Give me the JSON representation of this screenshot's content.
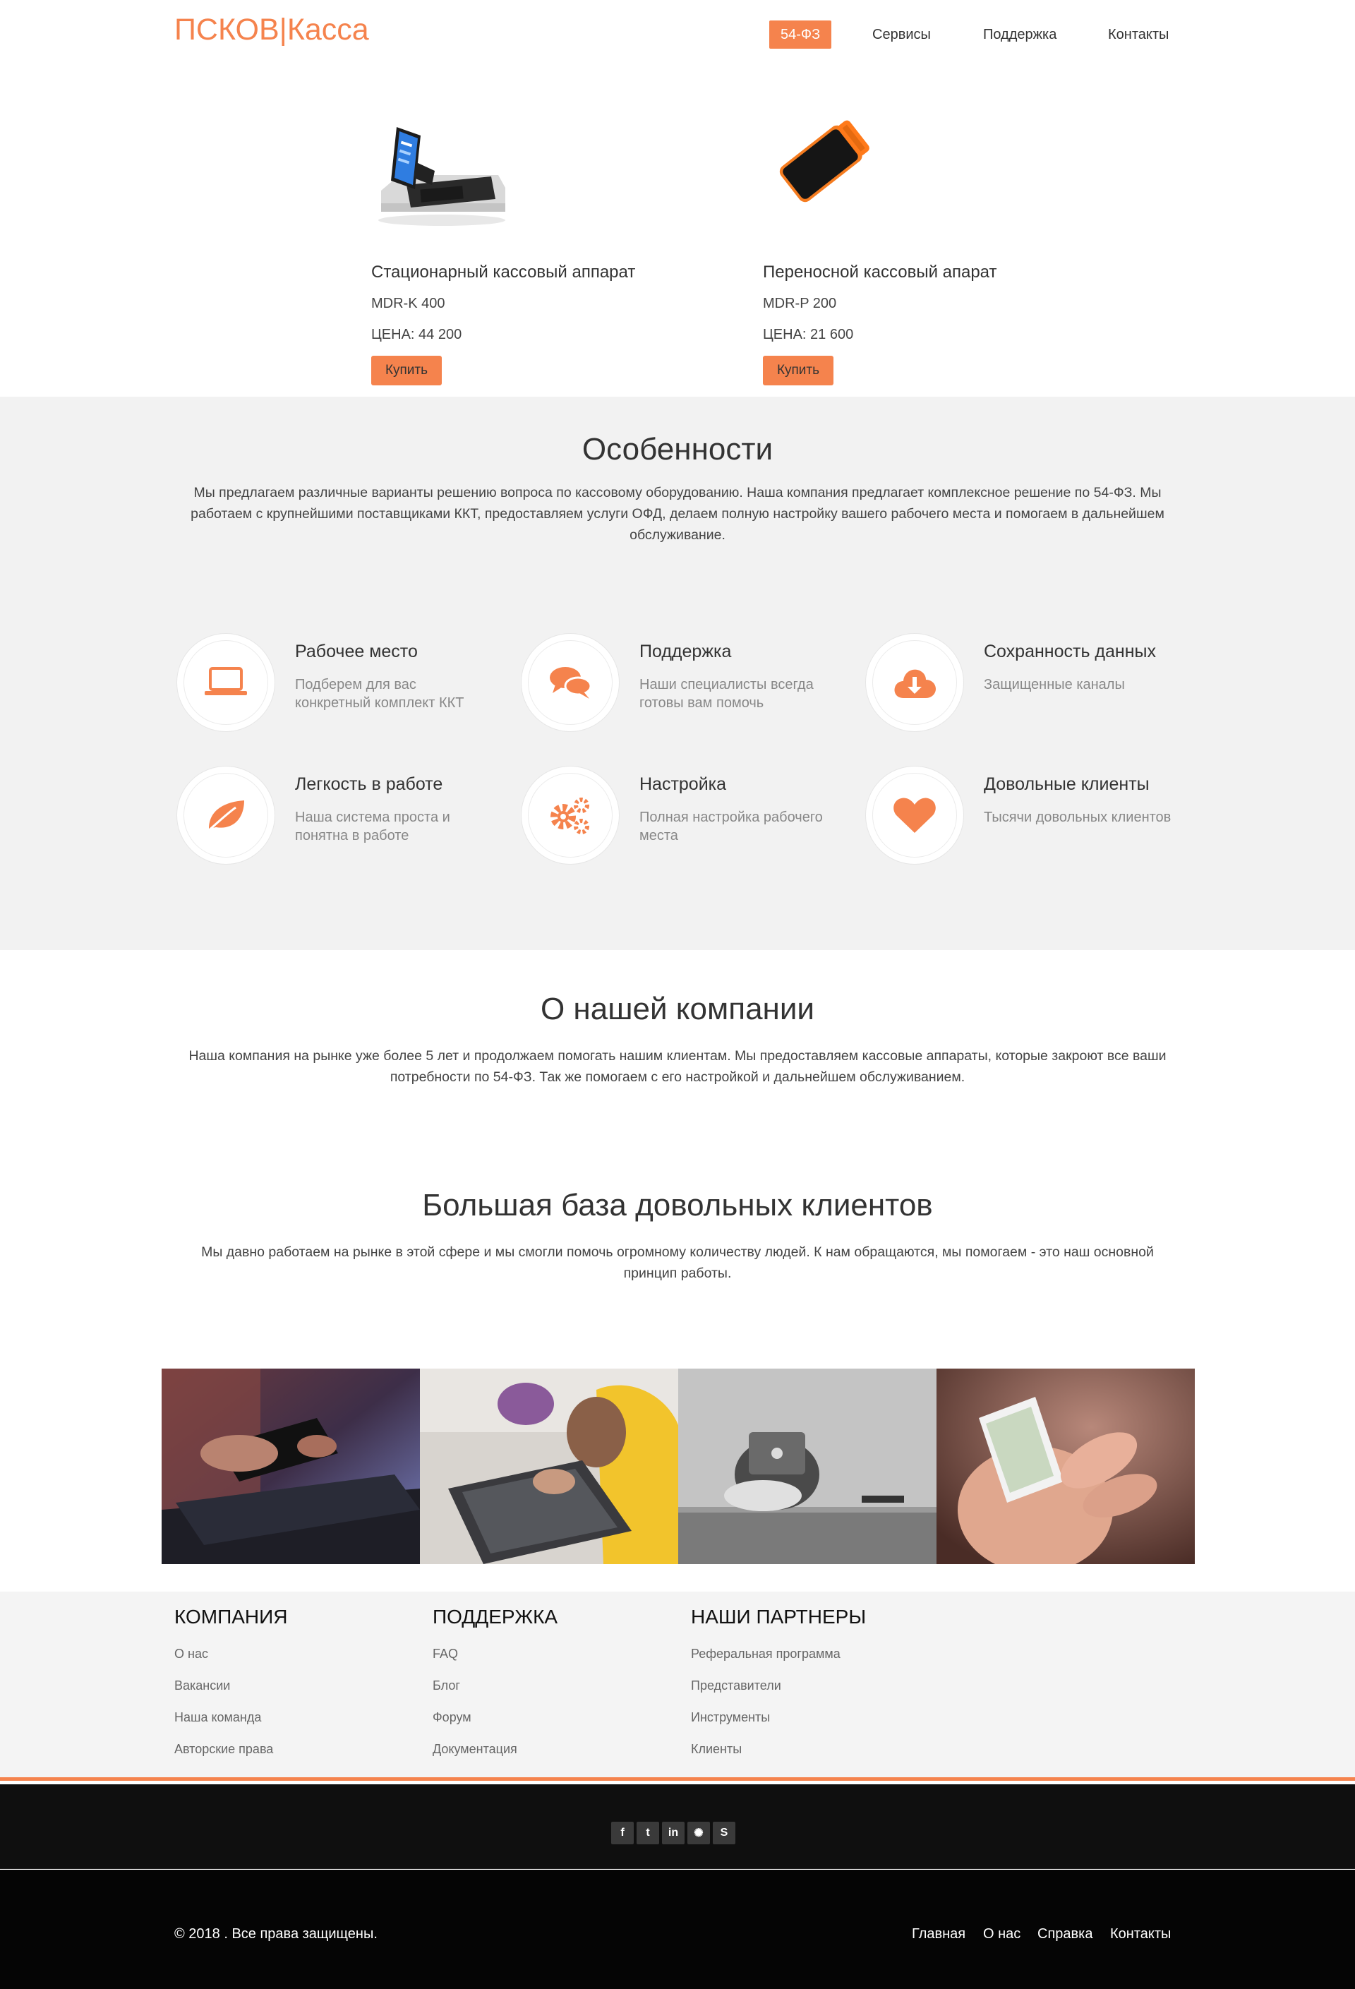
{
  "header": {
    "logo": "ПСКОВ|Касса",
    "nav": [
      {
        "label": "54-ФЗ",
        "active": true
      },
      {
        "label": "Сервисы"
      },
      {
        "label": "Поддержка"
      },
      {
        "label": "Контакты"
      }
    ]
  },
  "products": [
    {
      "title": "Стационарный кассовый аппарат",
      "model": "MDR-K 400",
      "price": "ЦЕНА: 44 200",
      "button": "Купить"
    },
    {
      "title": "Переносной кассовый апарат",
      "model": "MDR-P 200",
      "price": "ЦЕНА: 21 600",
      "button": "Купить"
    }
  ],
  "features": {
    "title": "Особенности",
    "text": "Мы предлагаем различные варианты решению вопроса по кассовому оборудованию. Наша компания предлагает комплексное решение по 54-ФЗ. Мы работаем с крупнейшими поставщиками ККТ, предоставляем услуги ОФД, делаем полную настройку вашего рабочего места и помогаем в дальнейшем обслуживание.",
    "items": [
      {
        "icon": "laptop-icon",
        "title": "Рабочее место",
        "text": "Подберем для вас конкретный комплект ККТ"
      },
      {
        "icon": "chat-icon",
        "title": "Поддержка",
        "text": "Наши специалисты всегда готовы вам помочь"
      },
      {
        "icon": "cloud-download-icon",
        "title": "Сохранность данных",
        "text": "Защищенные каналы"
      },
      {
        "icon": "leaf-icon",
        "title": "Легкость в работе",
        "text": "Наша система проста и понятна в работе"
      },
      {
        "icon": "gears-icon",
        "title": "Настройка",
        "text": "Полная настройка рабочего места"
      },
      {
        "icon": "heart-icon",
        "title": "Довольные клиенты",
        "text": "Тысячи довольных клиентов"
      }
    ]
  },
  "about": {
    "title": "О нашей компании",
    "text": "Наша компания на рынке уже более 5 лет и продолжаем помогать нашим клиентам. Мы предоставляем кассовые аппараты, которые закроют все ваши потребности по 54-ФЗ. Так же помогаем с его настройкой и дальнейшем обслуживанием."
  },
  "clients": {
    "title": "Большая база довольных клиентов",
    "text": "Мы давно работаем на рынке в этой сфере и мы смогли помочь огромному количеству людей. К нам обращаются, мы помогаем - это наш основной принцип работы."
  },
  "footer": {
    "columns": [
      {
        "title": "КОМПАНИЯ",
        "items": [
          "О нас",
          "Вакансии",
          "Наша команда",
          "Авторские права"
        ]
      },
      {
        "title": "ПОДДЕРЖКА",
        "items": [
          "FAQ",
          "Блог",
          "Форум",
          "Документация"
        ]
      },
      {
        "title": "НАШИ ПАРТНЕРЫ",
        "items": [
          "Реферальная программа",
          "Представители",
          "Инструменты",
          "Клиенты"
        ]
      }
    ],
    "social": [
      {
        "icon": "facebook-icon",
        "glyph": "f"
      },
      {
        "icon": "twitter-icon",
        "glyph": "t"
      },
      {
        "icon": "linkedin-icon",
        "glyph": "in"
      },
      {
        "icon": "dribbble-icon",
        "glyph": "✺"
      },
      {
        "icon": "skype-icon",
        "glyph": "S"
      }
    ],
    "copyright": "© 2018 . Все права защищены.",
    "bottom_nav": [
      "Главная",
      "О нас",
      "Справка",
      "Контакты"
    ]
  },
  "colors": {
    "accent": "#f5834d",
    "features_bg": "#f2f2f2",
    "footer_bg": "#f4f4f4",
    "dark": "#0f0f0f"
  }
}
